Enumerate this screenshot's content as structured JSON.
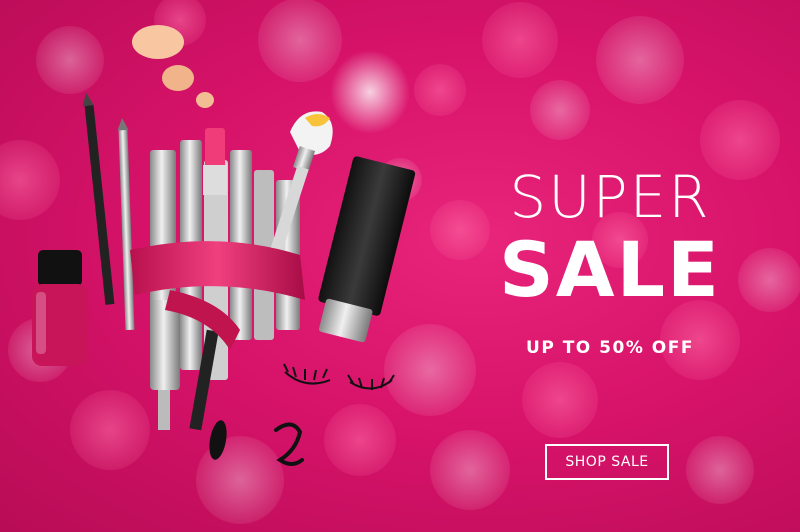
{
  "banner": {
    "headline_top": "SUPER",
    "headline_bottom": "SALE",
    "discount": "UP TO 50% OFF",
    "cta_label": "SHOP SALE"
  },
  "colors": {
    "background": "#d8136a",
    "text": "#ffffff",
    "accent_ribbon": "#e0306e"
  },
  "icons": [
    "nail-polish-icon",
    "makeup-brush-icon",
    "mascara-icon",
    "lipstick-icon",
    "cosmetic-tube-icon",
    "eyelash-icon",
    "eyeliner-pencil-icon"
  ]
}
